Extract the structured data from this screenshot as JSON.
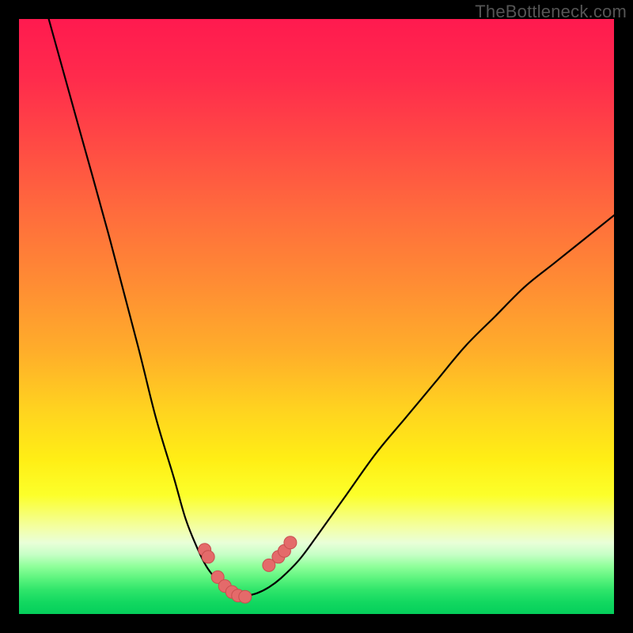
{
  "watermark": {
    "text": "TheBottleneck.com"
  },
  "colors": {
    "curve": "#000000",
    "marker_fill": "#e46a6a",
    "marker_stroke": "#c94f4f",
    "frame_bg_top": "#ff1a4f",
    "frame_bg_bottom": "#05cf5b"
  },
  "chart_data": {
    "type": "line",
    "title": "",
    "xlabel": "",
    "ylabel": "",
    "xlim": [
      0,
      100
    ],
    "ylim": [
      0,
      100
    ],
    "grid": false,
    "legend": false,
    "note": "Bottleneck-style V-curve. Axes are unlabeled; values are estimated from pixel positions. y≈100 at top of colored frame, y≈0 at bottom.",
    "series": [
      {
        "name": "left-branch",
        "x": [
          5,
          10,
          15,
          20,
          23,
          26,
          28,
          30,
          31.5,
          33,
          34,
          35,
          36,
          37,
          38
        ],
        "y": [
          100,
          82,
          64,
          45,
          33,
          23,
          16,
          11,
          8,
          6,
          5,
          4,
          3.5,
          3,
          3
        ]
      },
      {
        "name": "right-branch",
        "x": [
          38,
          40,
          42,
          44,
          47,
          50,
          55,
          60,
          65,
          70,
          75,
          80,
          85,
          90,
          95,
          100
        ],
        "y": [
          3,
          3.5,
          4.5,
          6,
          9,
          13,
          20,
          27,
          33,
          39,
          45,
          50,
          55,
          59,
          63,
          67
        ]
      }
    ],
    "markers_left": {
      "x": [
        31.2,
        31.8,
        33.4,
        34.6,
        35.8,
        36.8,
        38.0
      ],
      "y": [
        10.8,
        9.6,
        6.2,
        4.7,
        3.7,
        3.1,
        2.9
      ]
    },
    "markers_right": {
      "x": [
        42.0,
        43.6,
        44.6,
        45.6
      ],
      "y": [
        8.2,
        9.6,
        10.6,
        12.0
      ]
    }
  }
}
